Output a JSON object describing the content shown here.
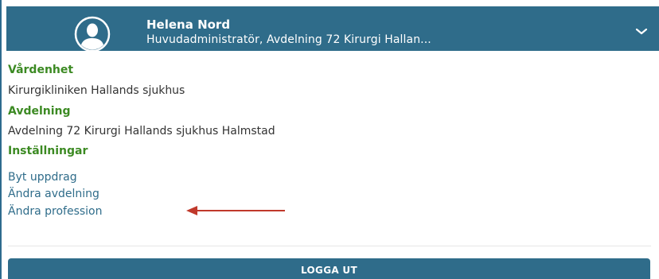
{
  "user": {
    "name": "Helena Nord",
    "role": "Huvudadministratör, Avdelning 72 Kirurgi Hallan..."
  },
  "icons": {
    "avatar": "user-avatar-icon",
    "chevron": "chevron-down-icon",
    "arrow": "left-arrow-annotation-icon"
  },
  "sections": {
    "vardenhet_label": "Vårdenhet",
    "vardenhet_value": "Kirurgikliniken Hallands sjukhus",
    "avdelning_label": "Avdelning",
    "avdelning_value": "Avdelning 72 Kirurgi Hallands sjukhus Halmstad",
    "installningar_label": "Inställningar"
  },
  "links": {
    "byt_uppdrag": "Byt uppdrag",
    "andra_avdelning": "Ändra avdelning",
    "andra_profession": "Ändra profession"
  },
  "logout_label": "LOGGA UT",
  "colors": {
    "header": "#2f6c8a",
    "section_label": "#3c8a23",
    "link": "#2f6c8a",
    "arrow": "#c0392b"
  }
}
